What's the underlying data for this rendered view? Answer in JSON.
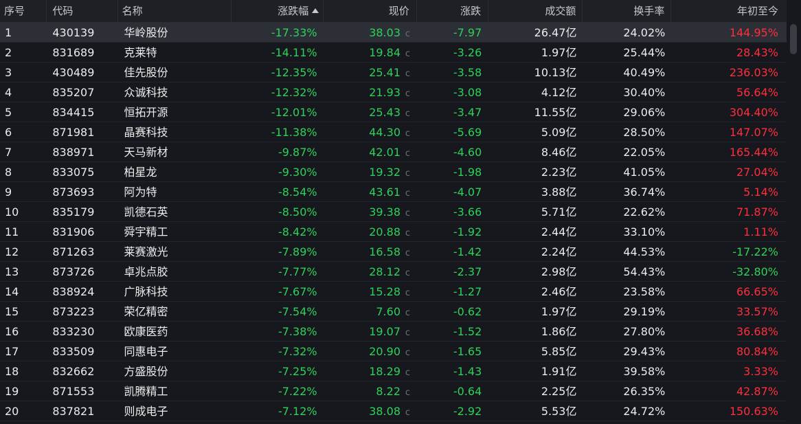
{
  "headers": {
    "idx": "序号",
    "code": "代码",
    "name": "名称",
    "pct": "涨跌幅",
    "price": "现价",
    "chg": "涨跌",
    "vol": "成交额",
    "turn": "换手率",
    "ytd": "年初至今"
  },
  "sort": {
    "column": "pct",
    "direction": "ascending"
  },
  "price_flag": "c",
  "colors": {
    "up": "#ff2e3d",
    "down": "#2ed15a",
    "selected_row": "#2c2f36"
  },
  "rows": [
    {
      "idx": "1",
      "code": "430139",
      "name": "华岭股份",
      "pct": "-17.33%",
      "price": "38.03",
      "chg": "-7.97",
      "vol": "26.47亿",
      "turn": "24.02%",
      "ytd": "144.95%"
    },
    {
      "idx": "2",
      "code": "831689",
      "name": "克莱特",
      "pct": "-14.11%",
      "price": "19.84",
      "chg": "-3.26",
      "vol": "1.97亿",
      "turn": "25.44%",
      "ytd": "28.43%"
    },
    {
      "idx": "3",
      "code": "430489",
      "name": "佳先股份",
      "pct": "-12.35%",
      "price": "25.41",
      "chg": "-3.58",
      "vol": "10.13亿",
      "turn": "40.49%",
      "ytd": "236.03%"
    },
    {
      "idx": "4",
      "code": "835207",
      "name": "众诚科技",
      "pct": "-12.32%",
      "price": "21.93",
      "chg": "-3.08",
      "vol": "4.12亿",
      "turn": "30.40%",
      "ytd": "56.64%"
    },
    {
      "idx": "5",
      "code": "834415",
      "name": "恒拓开源",
      "pct": "-12.01%",
      "price": "25.43",
      "chg": "-3.47",
      "vol": "11.55亿",
      "turn": "29.06%",
      "ytd": "304.40%"
    },
    {
      "idx": "6",
      "code": "871981",
      "name": "晶赛科技",
      "pct": "-11.38%",
      "price": "44.30",
      "chg": "-5.69",
      "vol": "5.09亿",
      "turn": "28.50%",
      "ytd": "147.07%"
    },
    {
      "idx": "7",
      "code": "838971",
      "name": "天马新材",
      "pct": "-9.87%",
      "price": "42.01",
      "chg": "-4.60",
      "vol": "8.46亿",
      "turn": "22.05%",
      "ytd": "165.44%"
    },
    {
      "idx": "8",
      "code": "833075",
      "name": "柏星龙",
      "pct": "-9.30%",
      "price": "19.32",
      "chg": "-1.98",
      "vol": "2.23亿",
      "turn": "41.05%",
      "ytd": "27.04%"
    },
    {
      "idx": "9",
      "code": "873693",
      "name": "阿为特",
      "pct": "-8.54%",
      "price": "43.61",
      "chg": "-4.07",
      "vol": "3.88亿",
      "turn": "36.74%",
      "ytd": "5.14%"
    },
    {
      "idx": "10",
      "code": "835179",
      "name": "凯德石英",
      "pct": "-8.50%",
      "price": "39.38",
      "chg": "-3.66",
      "vol": "5.71亿",
      "turn": "22.62%",
      "ytd": "71.87%"
    },
    {
      "idx": "11",
      "code": "831906",
      "name": "舜宇精工",
      "pct": "-8.42%",
      "price": "20.88",
      "chg": "-1.92",
      "vol": "2.44亿",
      "turn": "33.10%",
      "ytd": "1.11%"
    },
    {
      "idx": "12",
      "code": "871263",
      "name": "莱赛激光",
      "pct": "-7.89%",
      "price": "16.58",
      "chg": "-1.42",
      "vol": "2.24亿",
      "turn": "44.53%",
      "ytd": "-17.22%"
    },
    {
      "idx": "13",
      "code": "873726",
      "name": "卓兆点胶",
      "pct": "-7.77%",
      "price": "28.12",
      "chg": "-2.37",
      "vol": "2.98亿",
      "turn": "54.43%",
      "ytd": "-32.80%"
    },
    {
      "idx": "14",
      "code": "838924",
      "name": "广脉科技",
      "pct": "-7.67%",
      "price": "15.28",
      "chg": "-1.27",
      "vol": "2.46亿",
      "turn": "23.58%",
      "ytd": "66.65%"
    },
    {
      "idx": "15",
      "code": "873223",
      "name": "荣亿精密",
      "pct": "-7.54%",
      "price": "7.60",
      "chg": "-0.62",
      "vol": "1.97亿",
      "turn": "29.19%",
      "ytd": "33.57%"
    },
    {
      "idx": "16",
      "code": "833230",
      "name": "欧康医药",
      "pct": "-7.38%",
      "price": "19.07",
      "chg": "-1.52",
      "vol": "1.86亿",
      "turn": "27.80%",
      "ytd": "36.68%"
    },
    {
      "idx": "17",
      "code": "833509",
      "name": "同惠电子",
      "pct": "-7.32%",
      "price": "20.90",
      "chg": "-1.65",
      "vol": "5.85亿",
      "turn": "29.43%",
      "ytd": "80.84%"
    },
    {
      "idx": "18",
      "code": "832662",
      "name": "方盛股份",
      "pct": "-7.25%",
      "price": "18.29",
      "chg": "-1.43",
      "vol": "1.91亿",
      "turn": "39.58%",
      "ytd": "3.33%"
    },
    {
      "idx": "19",
      "code": "871553",
      "name": "凯腾精工",
      "pct": "-7.22%",
      "price": "8.22",
      "chg": "-0.64",
      "vol": "2.25亿",
      "turn": "26.35%",
      "ytd": "42.87%"
    },
    {
      "idx": "20",
      "code": "837821",
      "name": "则成电子",
      "pct": "-7.12%",
      "price": "38.08",
      "chg": "-2.92",
      "vol": "5.53亿",
      "turn": "24.72%",
      "ytd": "150.63%"
    }
  ]
}
